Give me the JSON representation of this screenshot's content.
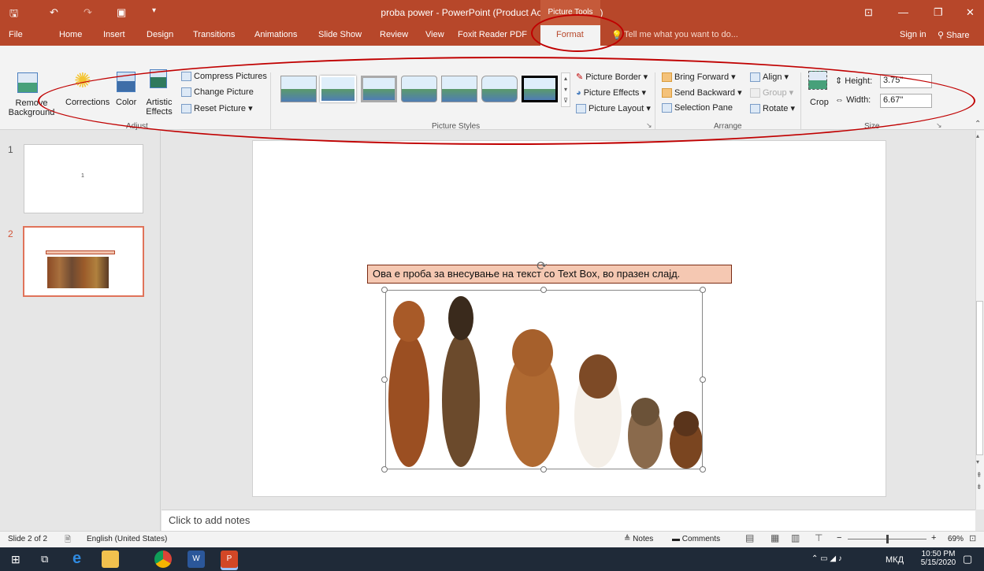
{
  "window": {
    "title": "proba power - PowerPoint (Product Activation Failed)",
    "context_tab": "Picture Tools",
    "sign_in": "Sign in",
    "share": "Share"
  },
  "tabs": [
    "File",
    "Home",
    "Insert",
    "Design",
    "Transitions",
    "Animations",
    "Slide Show",
    "Review",
    "View",
    "Foxit Reader PDF",
    "Format"
  ],
  "tell_me": "Tell me what you want to do...",
  "ribbon": {
    "adjust": {
      "remove_background": "Remove Background",
      "corrections": "Corrections",
      "color": "Color",
      "artistic_effects": "Artistic Effects",
      "compress": "Compress Pictures",
      "change": "Change Picture",
      "reset": "Reset Picture",
      "label": "Adjust"
    },
    "styles": {
      "border": "Picture Border",
      "effects": "Picture Effects",
      "layout": "Picture Layout",
      "label": "Picture Styles"
    },
    "arrange": {
      "bring_forward": "Bring Forward",
      "send_backward": "Send Backward",
      "selection_pane": "Selection Pane",
      "align": "Align",
      "group": "Group",
      "rotate": "Rotate",
      "label": "Arrange"
    },
    "size": {
      "crop": "Crop",
      "height_label": "Height:",
      "height_value": "3.75\"",
      "width_label": "Width:",
      "width_value": "6.67\"",
      "label": "Size"
    }
  },
  "slides": {
    "thumb1_number": "1",
    "thumb1_text": "1",
    "thumb2_number": "2"
  },
  "slide": {
    "textbox": "Ова е проба за внесување на текст со Text Box,  во празен слајд."
  },
  "notes_placeholder": "Click to add notes",
  "status": {
    "slide": "Slide 2 of 2",
    "language": "English (United States)",
    "notes": "Notes",
    "comments": "Comments",
    "zoom": "69%"
  },
  "taskbar": {
    "lang": "МКД",
    "time": "10:50 PM",
    "date": "5/15/2020"
  },
  "colors": {
    "accent": "#b7472a",
    "annotation": "#c00000"
  }
}
